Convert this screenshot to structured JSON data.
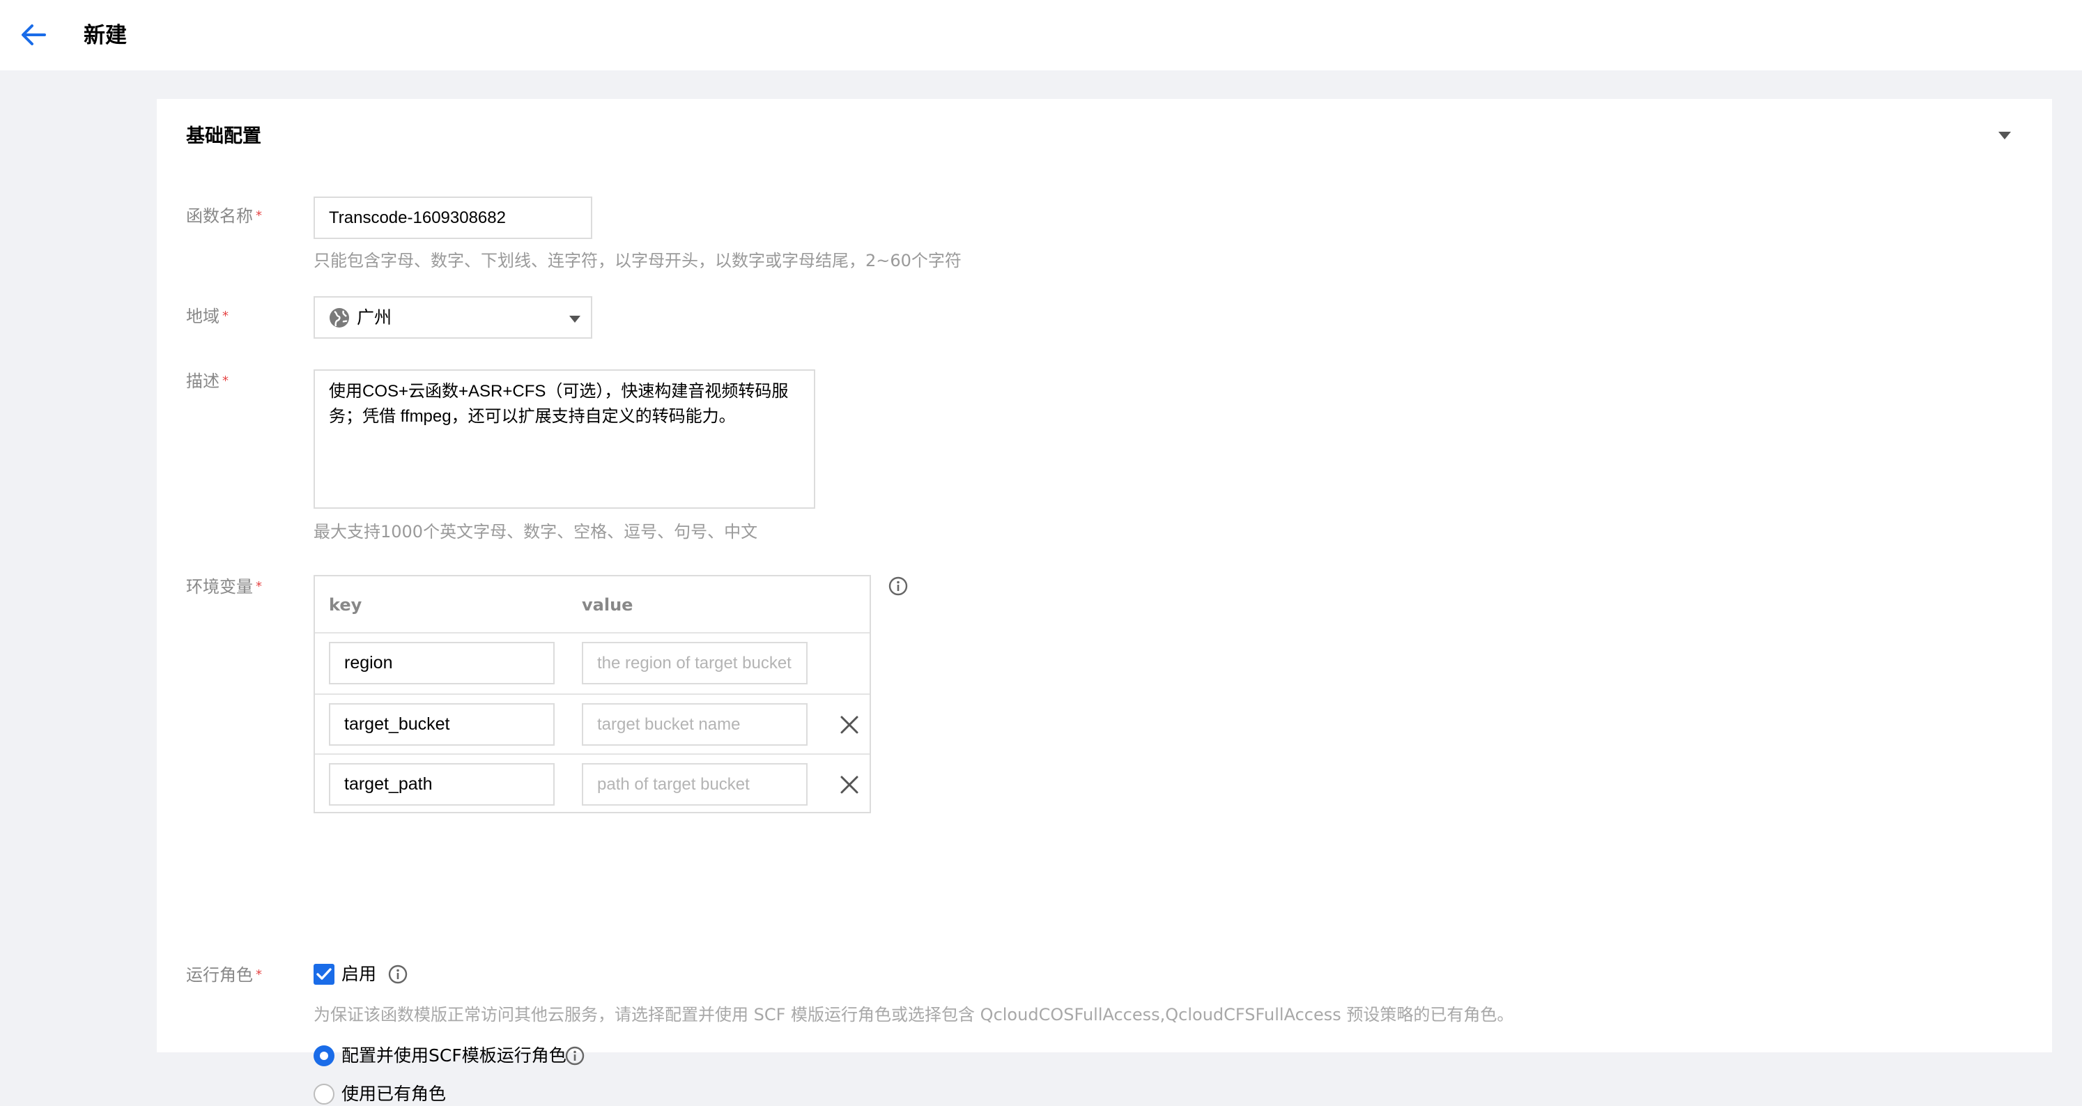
{
  "header": {
    "title": "新建"
  },
  "section": {
    "title": "基础配置"
  },
  "form": {
    "name": {
      "label": "函数名称",
      "value": "Transcode-1609308682",
      "hint": "只能包含字母、数字、下划线、连字符，以字母开头，以数字或字母结尾，2~60个字符"
    },
    "region": {
      "label": "地域",
      "value": "广州"
    },
    "description": {
      "label": "描述",
      "value": "使用COS+云函数+ASR+CFS（可选），快速构建音视频转码服务；凭借 ffmpeg，还可以扩展支持自定义的转码能力。",
      "hint": "最大支持1000个英文字母、数字、空格、逗号、句号、中文"
    },
    "env": {
      "label": "环境变量",
      "col_key": "key",
      "col_value": "value",
      "rows": [
        {
          "key": "region",
          "placeholder": "the region of target bucket"
        },
        {
          "key": "target_bucket",
          "placeholder": "target bucket name"
        },
        {
          "key": "target_path",
          "placeholder": "path of target bucket"
        }
      ]
    },
    "role": {
      "label": "运行角色",
      "enable_label": "启用",
      "enabled": true,
      "hint": "为保证该函数模版正常访问其他云服务，请选择配置并使用 SCF 模版运行角色或选择包含 QcloudCOSFullAccess,QcloudCFSFullAccess 预设策略的已有角色。",
      "options": [
        {
          "label": "配置并使用SCF模板运行角色",
          "selected": true
        },
        {
          "label": "使用已有角色",
          "selected": false
        }
      ]
    }
  },
  "colors": {
    "accent": "#1a6ce8",
    "required": "#e54545",
    "background": "#f1f2f5"
  }
}
